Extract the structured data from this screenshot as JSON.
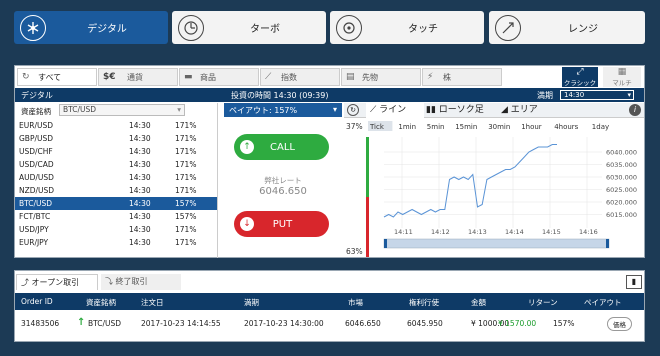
{
  "top_tabs": [
    {
      "label": "デジタル",
      "icon": "digital-icon"
    },
    {
      "label": "ターボ",
      "icon": "turbo-icon"
    },
    {
      "label": "タッチ",
      "icon": "touch-icon"
    },
    {
      "label": "レンジ",
      "icon": "range-icon"
    }
  ],
  "categories": [
    {
      "label": "すべて",
      "icon": "refresh-icon"
    },
    {
      "label": "通貨",
      "icon": "currency-icon",
      "prefix": "$€"
    },
    {
      "label": "商品",
      "icon": "commodity-icon"
    },
    {
      "label": "指数",
      "icon": "index-icon"
    },
    {
      "label": "先物",
      "icon": "futures-icon"
    },
    {
      "label": "株",
      "icon": "stock-icon"
    }
  ],
  "view_toggle": {
    "classic": "クラシック",
    "multi": "マルチ"
  },
  "header_bar": {
    "mode": "デジタル",
    "time_label": "投資の時間 14:30 (09:39)",
    "expiry_label": "満期",
    "expiry_value": "14:30"
  },
  "asset_list": {
    "label": "資産銘柄",
    "filter": "BTC/USD",
    "rows": [
      {
        "name": "EUR/USD",
        "time": "14:30",
        "payout": "171%"
      },
      {
        "name": "GBP/USD",
        "time": "14:30",
        "payout": "171%"
      },
      {
        "name": "USD/CHF",
        "time": "14:30",
        "payout": "171%"
      },
      {
        "name": "USD/CAD",
        "time": "14:30",
        "payout": "171%"
      },
      {
        "name": "AUD/USD",
        "time": "14:30",
        "payout": "171%"
      },
      {
        "name": "NZD/USD",
        "time": "14:30",
        "payout": "171%"
      },
      {
        "name": "BTC/USD",
        "time": "14:30",
        "payout": "157%"
      },
      {
        "name": "FCT/BTC",
        "time": "14:30",
        "payout": "157%"
      },
      {
        "name": "USD/JPY",
        "time": "14:30",
        "payout": "171%"
      },
      {
        "name": "EUR/JPY",
        "time": "14:30",
        "payout": "171%"
      }
    ],
    "selected_index": 6
  },
  "trade": {
    "payout_label": "ペイアウト: 157%",
    "call": "CALL",
    "put": "PUT",
    "rate_label": "弊社レート",
    "rate_value": "6046.650"
  },
  "chart_tabs": {
    "line": "ライン",
    "candle": "ローソク足",
    "area": "エリア",
    "info": "i"
  },
  "chart_data": {
    "type": "line",
    "intervals": [
      "Tick",
      "1min",
      "5min",
      "15min",
      "30min",
      "1hour",
      "4hours",
      "1day"
    ],
    "selected_interval": "Tick",
    "top_pct": "37%",
    "bottom_pct": "63%",
    "x_ticks": [
      "14:11",
      "14:12",
      "14:13",
      "14:14",
      "14:15",
      "14:16"
    ],
    "y_ticks": [
      "6040.000",
      "6035.000",
      "6030.000",
      "6025.000",
      "6020.000",
      "6015.000"
    ],
    "ylim": [
      6012,
      6046
    ],
    "series": [
      {
        "values": [
          6014,
          6015,
          6014,
          6016,
          6015,
          6016,
          6017,
          6016,
          6015,
          6016,
          6017,
          6016,
          6017,
          6017,
          6029,
          6030,
          6029,
          6030,
          6029,
          6031,
          6018,
          6019,
          6029,
          6030,
          6031,
          6032,
          6033,
          6033,
          6034,
          6036,
          6038,
          6040,
          6041,
          6042,
          6042,
          6042,
          6043,
          6043
        ]
      }
    ]
  },
  "bottom": {
    "tab_open": "オープン取引",
    "tab_closed": "終了取引",
    "columns": [
      "Order ID",
      "資産銘柄",
      "注文日",
      "満期",
      "市場",
      "権利行使",
      "金額",
      "リターン",
      "ペイアウト"
    ],
    "rows": [
      {
        "id": "31483506",
        "asset": "BTC/USD",
        "order_date": "2017-10-23 14:14:55",
        "expiry": "2017-10-23 14:30:00",
        "market": "6046.650",
        "strike": "6045.950",
        "amount": "¥ 1000.00",
        "return": "¥ 1570.00",
        "payout": "157%",
        "action": "価格"
      }
    ]
  },
  "colors": {
    "call": "#2eab40",
    "put": "#d8262c",
    "accent": "#1b5a9c",
    "return": "#1b9c2c"
  }
}
